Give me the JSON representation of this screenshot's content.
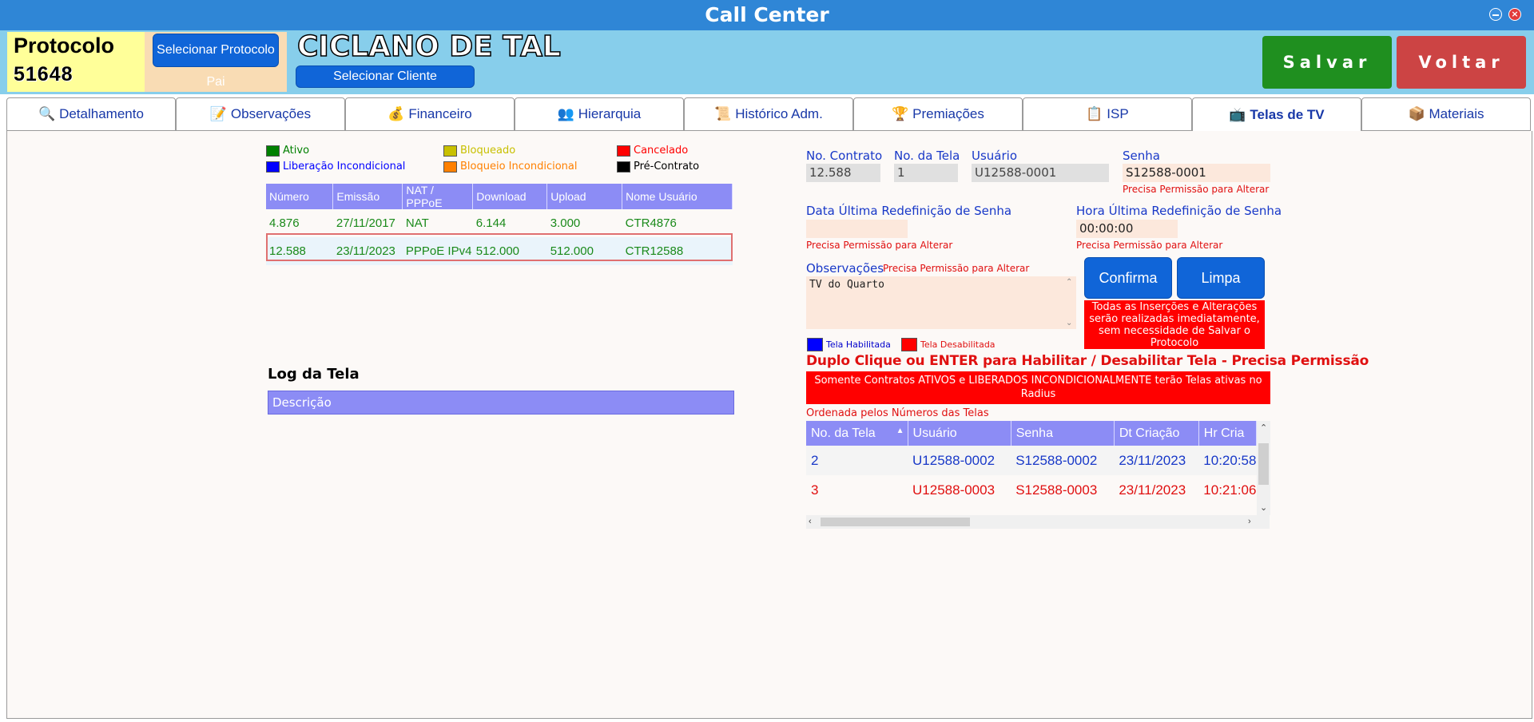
{
  "window": {
    "title": "Call Center"
  },
  "header": {
    "protocol_label": "Protocolo",
    "protocol_number": "51648",
    "select_parent_button": "Selecionar Protocolo Pai",
    "client_name": "CICLANO DE TAL",
    "select_client_button": "Selecionar Cliente",
    "save_button": "Salvar",
    "back_button": "Voltar"
  },
  "tabs": [
    {
      "label": "Detalhamento",
      "icon": "magnifier-document-icon"
    },
    {
      "label": "Observações",
      "icon": "notes-icon"
    },
    {
      "label": "Financeiro",
      "icon": "money-bag-icon"
    },
    {
      "label": "Hierarquia",
      "icon": "hierarchy-icon"
    },
    {
      "label": "Histórico Adm.",
      "icon": "history-icon"
    },
    {
      "label": "Premiações",
      "icon": "award-icon"
    },
    {
      "label": "ISP",
      "icon": "isp-icon"
    },
    {
      "label": "Telas de TV",
      "icon": "tv-screens-icon",
      "active": true
    },
    {
      "label": "Materiais",
      "icon": "materials-icon"
    }
  ],
  "legend": [
    {
      "label": "Ativo",
      "color": "#008000"
    },
    {
      "label": "Bloqueado",
      "color": "#c8c000"
    },
    {
      "label": "Cancelado",
      "color": "#ff0000"
    },
    {
      "label": "Liberação Incondicional",
      "color": "#0000ff"
    },
    {
      "label": "Bloqueio Incondicional",
      "color": "#ff8000"
    },
    {
      "label": "Pré-Contrato",
      "color": "#000000"
    }
  ],
  "contracts": {
    "headers": [
      "Número",
      "Emissão",
      "NAT / PPPoE",
      "Download",
      "Upload",
      "Nome Usuário"
    ],
    "rows": [
      [
        "4.876",
        "27/11/2017",
        "NAT",
        "6.144",
        "3.000",
        "CTR4876"
      ],
      [
        "12.588",
        "23/11/2023",
        "PPPoE IPv4",
        "512.000",
        "512.000",
        "CTR12588"
      ]
    ]
  },
  "log": {
    "title": "Log da Tela",
    "column": "Descrição"
  },
  "form": {
    "contract_label": "No. Contrato",
    "contract_value": "12.588",
    "screen_label": "No. da Tela",
    "screen_value": "1",
    "user_label": "Usuário",
    "user_value": "U12588-0001",
    "password_label": "Senha",
    "password_value": "S12588-0001",
    "permission_warning": "Precisa Permissão para Alterar",
    "last_reset_date_label": "Data Última Redefinição de Senha",
    "last_reset_date_value": "",
    "last_reset_time_label": "Hora Última Redefinição de Senha",
    "last_reset_time_value": "00:00:00",
    "obs_label": "Observações",
    "obs_value": "TV do Quarto",
    "confirm_button": "Confirma",
    "clear_button": "Limpa",
    "immediate_notice": "Todas as Inserções e Alterações serão realizadas imediatamente, sem necessidade de Salvar o Protocolo"
  },
  "screen_legend": [
    {
      "label": "Tela Habilitada",
      "color": "#0000ff"
    },
    {
      "label": "Tela Desabilitada",
      "color": "#ff0000"
    }
  ],
  "instructions": {
    "double_click": "Duplo Clique ou ENTER para Habilitar / Desabilitar Tela - Precisa Permissão",
    "radius_notice": "Somente Contratos ATIVOS e LIBERADOS INCONDICIONALMENTE terão Telas ativas no Radius",
    "sort_note": "Ordenada pelos Números das Telas"
  },
  "screens": {
    "headers": [
      "No. da Tela",
      "Usuário",
      "Senha",
      "Dt Criação",
      "Hr Cria"
    ],
    "rows": [
      [
        "2",
        "U12588-0002",
        "S12588-0002",
        "23/11/2023",
        "10:20:58"
      ],
      [
        "3",
        "U12588-0003",
        "S12588-0003",
        "23/11/2023",
        "10:21:06"
      ]
    ]
  }
}
